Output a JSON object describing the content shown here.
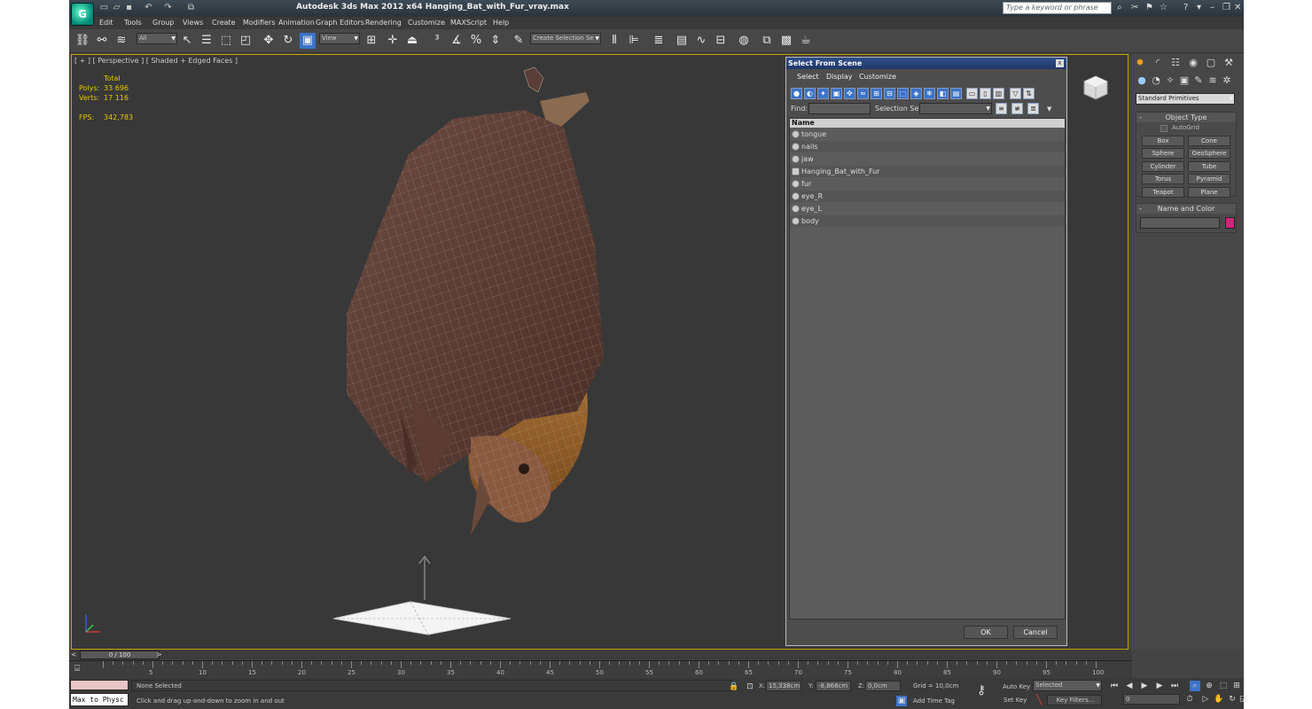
{
  "window": {
    "title": "Autodesk 3ds Max  2012 x64     Hanging_Bat_with_Fur_vray.max",
    "search_placeholder": "Type a keyword or phrase",
    "logo_glyph": "G"
  },
  "menu": [
    "Edit",
    "Tools",
    "Group",
    "Views",
    "Create",
    "Modifiers",
    "Animation",
    "Graph Editors",
    "Rendering",
    "Customize",
    "MAXScript",
    "Help"
  ],
  "toolbar": {
    "filter_value": "All",
    "coord_value": "View",
    "selection_set_placeholder": "Create Selection Se"
  },
  "viewport": {
    "label": "[ + ] [ Perspective ] [ Shaded + Edged Faces ]",
    "stats": {
      "total_label": "Total",
      "polys_label": "Polys:",
      "polys_value": "33 696",
      "verts_label": "Verts:",
      "verts_value": "17 116",
      "fps_label": "FPS:",
      "fps_value": "342,783"
    }
  },
  "dialog": {
    "title": "Select From Scene",
    "close": "x",
    "menus": [
      "Select",
      "Display",
      "Customize"
    ],
    "find_label": "Find:",
    "selection_set_label": "Selection Set:",
    "column_header": "Name",
    "objects": [
      "tongue",
      "nails",
      "jaw",
      "Hanging_Bat_with_Fur",
      "fur",
      "eye_R",
      "eye_L",
      "body"
    ],
    "ok": "OK",
    "cancel": "Cancel"
  },
  "command_panel": {
    "category": "Standard Primitives",
    "object_type_title": "Object Type",
    "autogrid_label": "AutoGrid",
    "buttons": [
      "Box",
      "Cone",
      "Sphere",
      "GeoSphere",
      "Cylinder",
      "Tube",
      "Torus",
      "Pyramid",
      "Teapot",
      "Plane"
    ],
    "name_color_title": "Name and Color",
    "color_swatch": "#d4237a"
  },
  "timeline": {
    "frame_display": "0 / 100",
    "ticks": [
      "5",
      "10",
      "15",
      "20",
      "25",
      "30",
      "35",
      "40",
      "45",
      "50",
      "55",
      "60",
      "65",
      "70",
      "75",
      "80",
      "85",
      "90",
      "95",
      "100"
    ]
  },
  "status": {
    "maxscript_text": "Max to Physc",
    "selection_status": "None Selected",
    "prompt": "Click and drag up-and-down to zoom in and out",
    "x_label": "X:",
    "x_value": "15,338cm",
    "y_label": "Y:",
    "y_value": "-8,868cm",
    "z_label": "Z:",
    "z_value": "0,0cm",
    "grid": "Grid = 10,0cm",
    "add_time_tag": "Add Time Tag",
    "auto_key": "Auto Key",
    "set_key": "Set Key",
    "key_mode": "Selected",
    "key_filters": "Key Filters...",
    "frame_value": "0"
  }
}
